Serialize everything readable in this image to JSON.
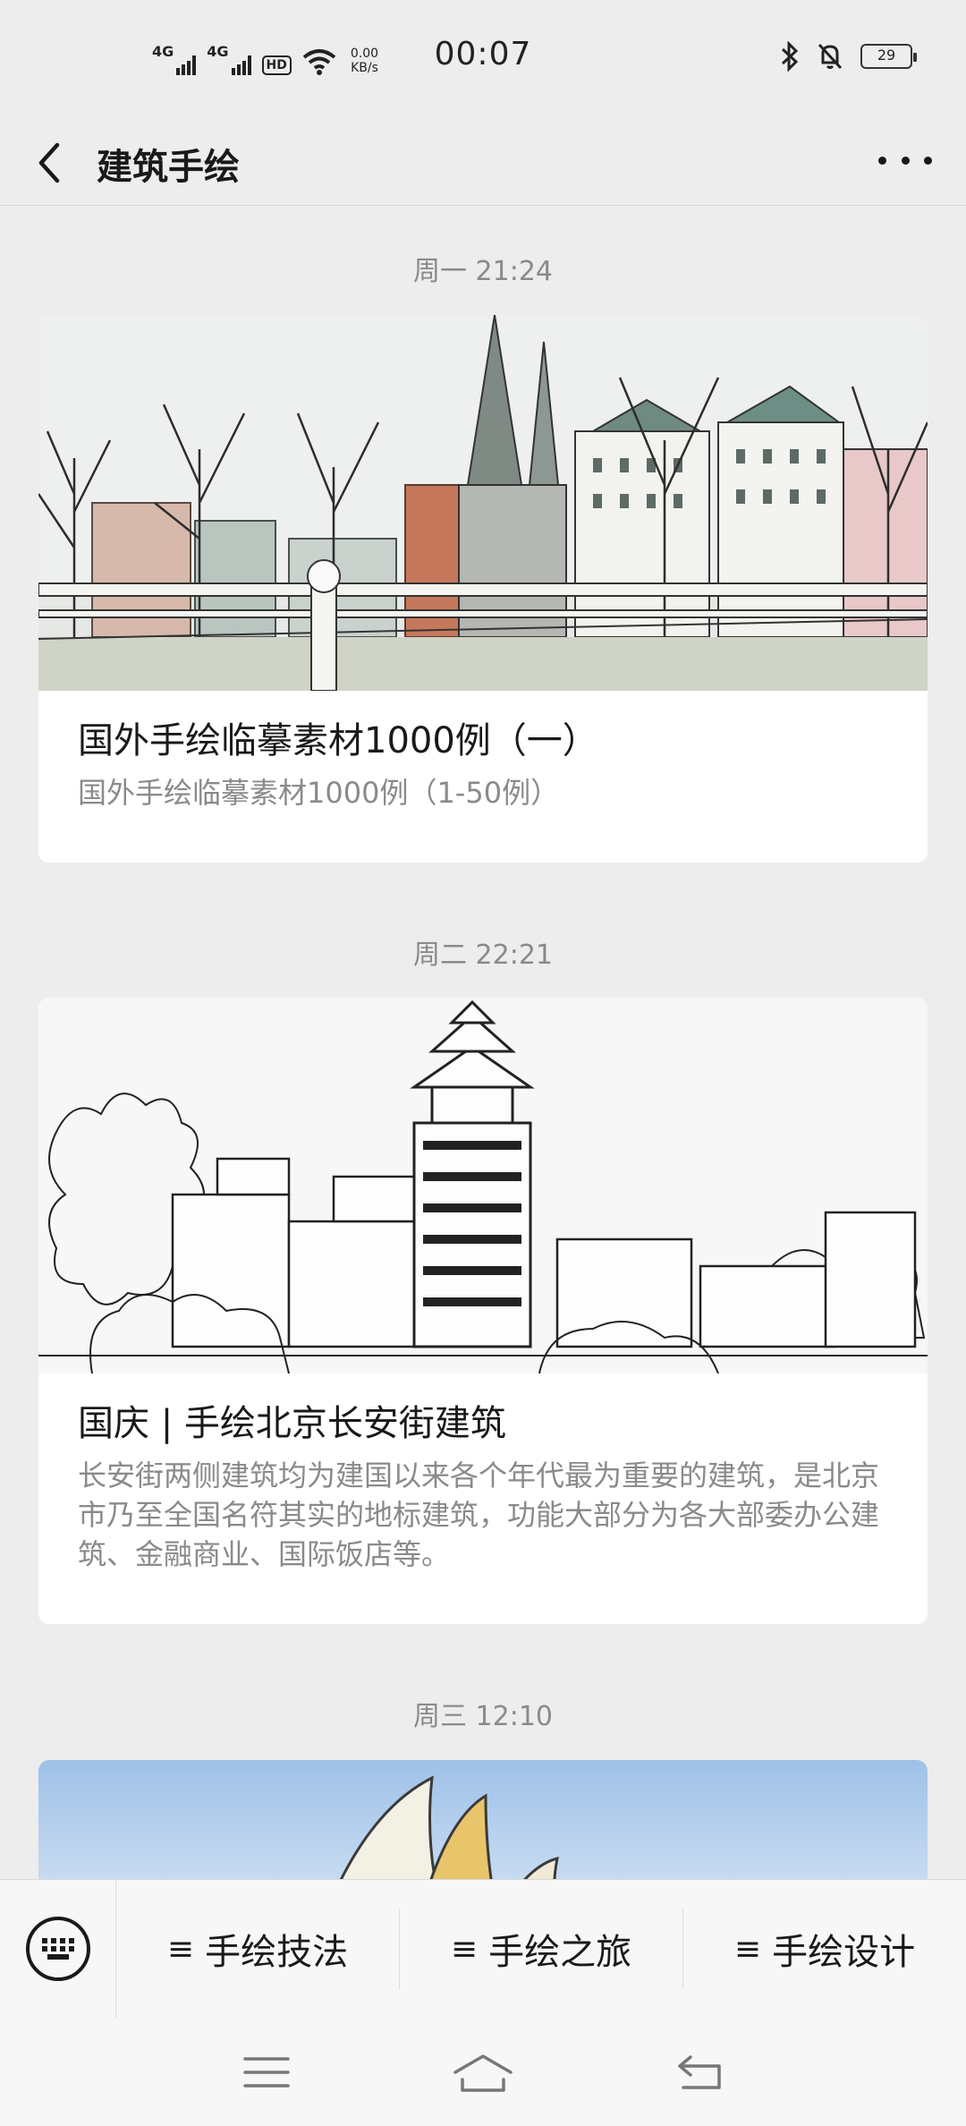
{
  "status_bar": {
    "net1": "4G",
    "net2": "4G",
    "hd": "HD",
    "speed_value": "0.00",
    "speed_unit": "KB/s",
    "time": "00:07",
    "battery": "29"
  },
  "header": {
    "title": "建筑手绘"
  },
  "feed": [
    {
      "timestamp": "周一 21:24",
      "title": "国外手绘临摹素材1000例（一）",
      "desc": "国外手绘临摹素材1000例（1-50例）"
    },
    {
      "timestamp": "周二 22:21",
      "title": "国庆 | 手绘北京长安街建筑",
      "desc": "长安街两侧建筑均为建国以来各个年代最为重要的建筑，是北京市乃至全国名符其实的地标建筑，功能大部分为各大部委办公建筑、金融商业、国际饭店等。"
    },
    {
      "timestamp": "周三 12:10"
    }
  ],
  "bottom_menu": {
    "items": [
      "手绘技法",
      "手绘之旅",
      "手绘设计"
    ],
    "icon": "≡"
  },
  "colors": {
    "background": "#ededed",
    "card": "#ffffff",
    "muted_text": "#8a8a8a"
  }
}
